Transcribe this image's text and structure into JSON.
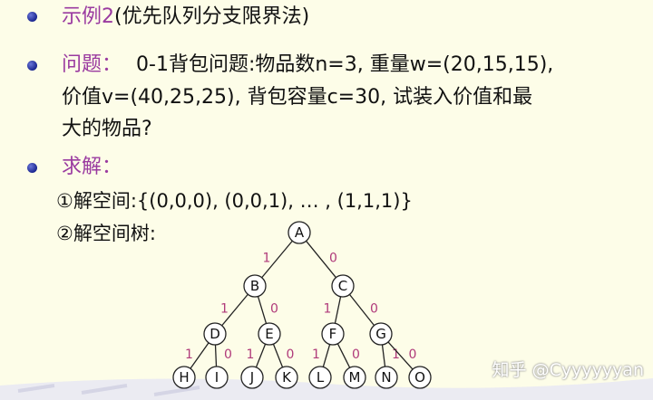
{
  "slide": {
    "title_prefix": "示例2",
    "title_paren": "(优先队列分支限界法)",
    "problem_label": "问题：",
    "problem_line1": "0-1背包问题:物品数n=3, 重量w=(20,15,15),",
    "problem_line2": "价值v=(40,25,25), 背包容量c=30, 试装入价值和最",
    "problem_line3": "大的物品?",
    "solve_label": "求解：",
    "step1": "①解空间:{(0,0,0), (0,0,1), … , (1,1,1)}",
    "step2": "②解空间树:"
  },
  "tree": {
    "nodes": [
      {
        "id": "A",
        "label": "A"
      },
      {
        "id": "B",
        "label": "B"
      },
      {
        "id": "C",
        "label": "C"
      },
      {
        "id": "D",
        "label": "D"
      },
      {
        "id": "E",
        "label": "E"
      },
      {
        "id": "F",
        "label": "F"
      },
      {
        "id": "G",
        "label": "G"
      },
      {
        "id": "H",
        "label": "H"
      },
      {
        "id": "I",
        "label": "I"
      },
      {
        "id": "J",
        "label": "J"
      },
      {
        "id": "K",
        "label": "K"
      },
      {
        "id": "L",
        "label": "L"
      },
      {
        "id": "M",
        "label": "M"
      },
      {
        "id": "N",
        "label": "N"
      },
      {
        "id": "O",
        "label": "O"
      }
    ],
    "edges": [
      {
        "from": "A",
        "to": "B",
        "label": "1"
      },
      {
        "from": "A",
        "to": "C",
        "label": "0"
      },
      {
        "from": "B",
        "to": "D",
        "label": "1"
      },
      {
        "from": "B",
        "to": "E",
        "label": "0"
      },
      {
        "from": "C",
        "to": "F",
        "label": "1"
      },
      {
        "from": "C",
        "to": "G",
        "label": "0"
      },
      {
        "from": "D",
        "to": "H",
        "label": "1"
      },
      {
        "from": "D",
        "to": "I",
        "label": "0"
      },
      {
        "from": "E",
        "to": "J",
        "label": "1"
      },
      {
        "from": "E",
        "to": "K",
        "label": "0"
      },
      {
        "from": "F",
        "to": "L",
        "label": "1"
      },
      {
        "from": "F",
        "to": "M",
        "label": "0"
      },
      {
        "from": "G",
        "to": "N",
        "label": "1"
      },
      {
        "from": "G",
        "to": "O",
        "label": "0"
      }
    ]
  },
  "watermark": "知乎 @Cyyyyyyan",
  "colors": {
    "highlight": "#9a3aa0",
    "edge_label": "#b03a7a",
    "bullet": "#1a2690"
  }
}
